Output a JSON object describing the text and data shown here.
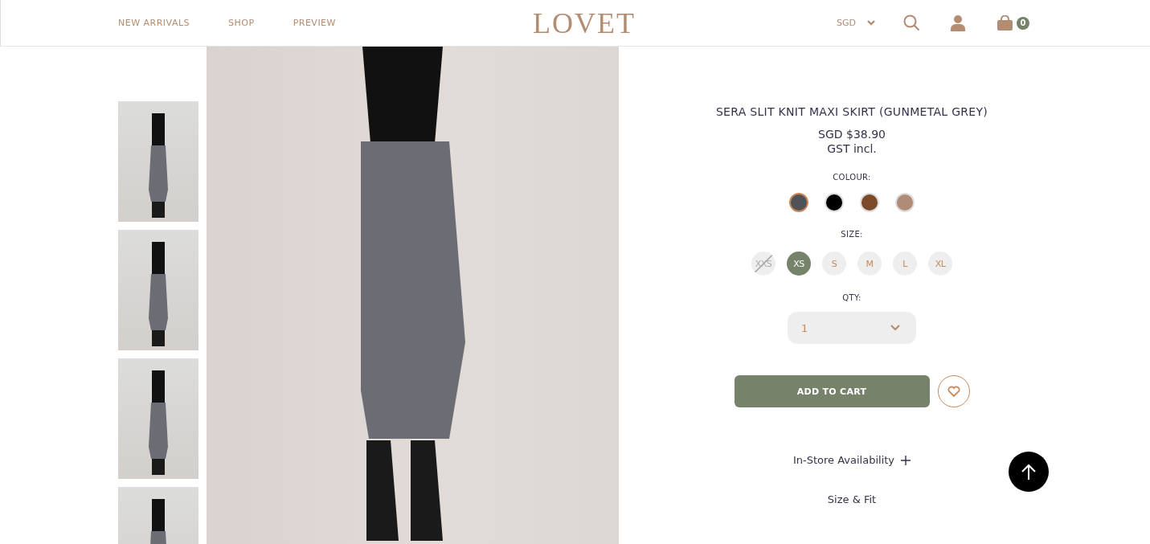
{
  "nav": [
    "NEW ARRIVALS",
    "SHOP",
    "PREVIEW"
  ],
  "logo": "LOVET",
  "currency": "SGD",
  "cart_count": "0",
  "product": {
    "title": "SERA SLIT KNIT MAXI SKIRT (GUNMETAL GREY)",
    "price": "SGD $38.90",
    "tax_note": "GST incl.",
    "colour_label": "COLOUR:",
    "colours": [
      {
        "color": "#505256",
        "selected": true
      },
      {
        "color": "#000000",
        "selected": false
      },
      {
        "color": "#7a4a2a",
        "selected": false
      },
      {
        "color": "#b08c78",
        "selected": false
      }
    ],
    "size_label": "SIZE:",
    "sizes": [
      {
        "label": "XXS",
        "selected": false,
        "available": false
      },
      {
        "label": "XS",
        "selected": true,
        "available": true
      },
      {
        "label": "S",
        "selected": false,
        "available": true
      },
      {
        "label": "M",
        "selected": false,
        "available": true
      },
      {
        "label": "L",
        "selected": false,
        "available": true
      },
      {
        "label": "XL",
        "selected": false,
        "available": true
      }
    ],
    "qty_label": "QTY:",
    "qty": "1",
    "add_to_cart": "ADD TO CART",
    "sections": [
      "In-Store Availability",
      "Size & Fit"
    ]
  }
}
